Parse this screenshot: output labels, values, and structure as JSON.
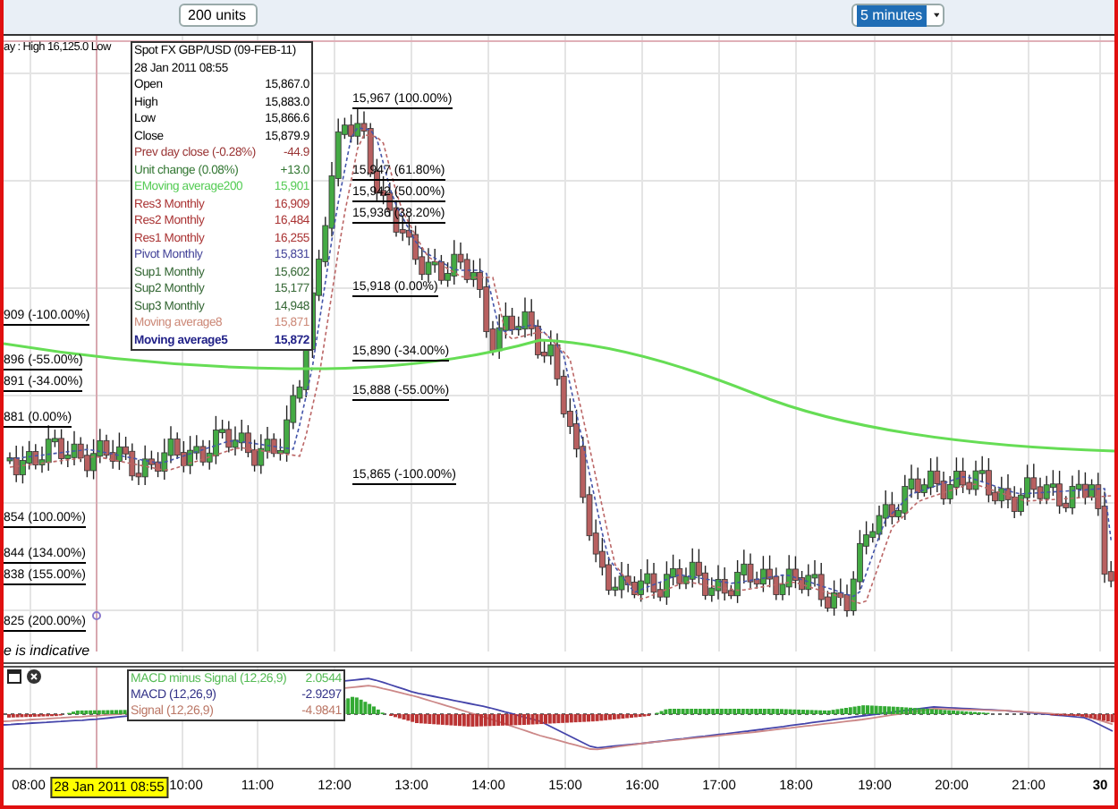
{
  "dropdowns": [
    {
      "value": "200 units",
      "selected": false
    },
    {
      "value": "5 minutes",
      "selected": true
    }
  ],
  "chart": {
    "header": "ay : High 16,125.0 Low",
    "tooltip": {
      "title": "Spot FX GBP/USD (09-FEB-11)",
      "time": "28 Jan 2011 08:55",
      "rows": [
        {
          "label": "Open",
          "value": "15,867.0",
          "color": "#000000"
        },
        {
          "label": "High",
          "value": "15,883.0",
          "color": "#000000"
        },
        {
          "label": "Low",
          "value": "15,866.6",
          "color": "#000000"
        },
        {
          "label": "Close",
          "value": "15,879.9",
          "color": "#000000"
        },
        {
          "label": "Prev day close (-0.28%)",
          "value": "-44.9",
          "color": "#993333"
        },
        {
          "label": "Unit change (0.08%)",
          "value": "+13.0",
          "color": "#337733"
        },
        {
          "label": "EMoving average200",
          "value": "15,901",
          "color": "#55cc55"
        },
        {
          "label": "Res3 Monthly",
          "value": "16,909",
          "color": "#aa3333"
        },
        {
          "label": "Res2 Monthly",
          "value": "16,484",
          "color": "#aa3333"
        },
        {
          "label": "Res1 Monthly",
          "value": "16,255",
          "color": "#aa3333"
        },
        {
          "label": "Pivot Monthly",
          "value": "15,831",
          "color": "#444499"
        },
        {
          "label": "Sup1 Monthly",
          "value": "15,602",
          "color": "#336633"
        },
        {
          "label": "Sup2 Monthly",
          "value": "15,177",
          "color": "#336633"
        },
        {
          "label": "Sup3 Monthly",
          "value": "14,948",
          "color": "#336633"
        },
        {
          "label": "Moving average8",
          "value": "15,871",
          "color": "#cc8877"
        },
        {
          "label": "Moving average5",
          "value": "15,872",
          "color": "#222288"
        }
      ]
    },
    "fib_labels_left": [
      "909 (-100.00%)",
      "896 (-55.00%)",
      "891 (-34.00%)",
      "881 (0.00%)",
      "854 (100.00%)",
      "844 (134.00%)",
      "838 (155.00%)",
      "825 (200.00%)"
    ],
    "fib_labels_mid": [
      "15,967 (100.00%)",
      "15,947 (61.80%)",
      "15,942 (50.00%)",
      "15,936 (38.20%)",
      "15,918 (0.00%)",
      "15,890 (-34.00%)",
      "15,888 (-55.00%)",
      "15,865 (-100.00%)"
    ],
    "notice": "e is indicative"
  },
  "macd": {
    "legend": [
      {
        "label": "MACD minus Signal (12,26,9)",
        "value": "2.0544",
        "color": "#55bb55"
      },
      {
        "label": "MACD (12,26,9)",
        "value": "-2.9297",
        "color": "#333388"
      },
      {
        "label": "Signal (12,26,9)",
        "value": "-4.9841",
        "color": "#bb7766"
      }
    ]
  },
  "time_axis": [
    {
      "label": "08:00",
      "kind": "tick"
    },
    {
      "label": "28 Jan 2011 08:55",
      "kind": "cursor"
    },
    {
      "label": "10:00",
      "kind": "tick"
    },
    {
      "label": "11:00",
      "kind": "tick"
    },
    {
      "label": "12:00",
      "kind": "tick"
    },
    {
      "label": "13:00",
      "kind": "tick"
    },
    {
      "label": "14:00",
      "kind": "tick"
    },
    {
      "label": "15:00",
      "kind": "tick"
    },
    {
      "label": "16:00",
      "kind": "tick"
    },
    {
      "label": "17:00",
      "kind": "tick"
    },
    {
      "label": "18:00",
      "kind": "tick"
    },
    {
      "label": "19:00",
      "kind": "tick"
    },
    {
      "label": "20:00",
      "kind": "tick"
    },
    {
      "label": "21:00",
      "kind": "tick"
    },
    {
      "label": "30",
      "kind": "day"
    }
  ]
}
